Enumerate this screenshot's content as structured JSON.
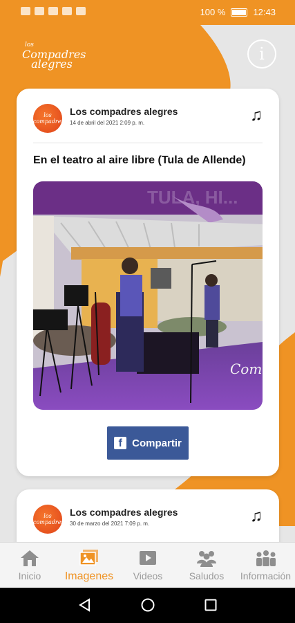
{
  "status_bar": {
    "battery": "100 %",
    "time": "12:43"
  },
  "header": {
    "logo_small": "los",
    "logo_big": "Compadres alegres",
    "info_icon": "info-circle-icon"
  },
  "posts": [
    {
      "author": "Los compadres alegres",
      "date": "14 de abril del 2021 2:09 p. m.",
      "title": "En el teatro al aire libre (Tula de Allende)",
      "banner_text": "TULA, HI...",
      "watermark": "Compadres alegres",
      "share_label": "Compartir",
      "music_icon": "music-note-icon"
    },
    {
      "author": "Los compadres alegres",
      "date": "30 de marzo del 2021 7:09 p. m.",
      "music_icon": "music-note-icon"
    }
  ],
  "bottom_nav": [
    {
      "label": "Inicio",
      "icon": "home-icon",
      "active": false
    },
    {
      "label": "Imagenes",
      "icon": "images-icon",
      "active": true
    },
    {
      "label": "Videos",
      "icon": "video-icon",
      "active": false
    },
    {
      "label": "Saludos",
      "icon": "people-icon",
      "active": false
    },
    {
      "label": "Información",
      "icon": "group-icon",
      "active": false
    }
  ],
  "colors": {
    "accent": "#ef9324",
    "facebook": "#3b5998",
    "inactive": "#9a9a9a"
  }
}
